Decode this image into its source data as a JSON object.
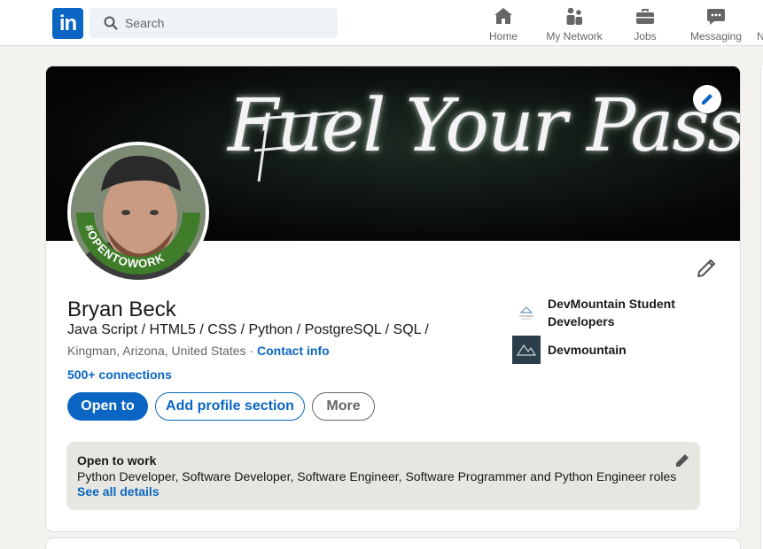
{
  "nav": {
    "logo": "in",
    "search_placeholder": "Search",
    "items": [
      {
        "label": "Home",
        "icon": "home-icon"
      },
      {
        "label": "My Network",
        "icon": "my-network-icon"
      },
      {
        "label": "Jobs",
        "icon": "jobs-icon"
      },
      {
        "label": "Messaging",
        "icon": "messaging-icon"
      },
      {
        "label": "N",
        "icon": "notifications-icon"
      }
    ]
  },
  "profile": {
    "banner_text": "Fuel Your Passion",
    "avatar_badge": "#OPENTOWORK",
    "name": "Bryan Beck",
    "headline": "Java Script / HTML5 / CSS / Python / PostgreSQL / SQL /",
    "location": "Kingman, Arizona, United States",
    "separator": " · ",
    "contact_info": "Contact info",
    "connections": "500+ connections",
    "buttons": {
      "open_to": "Open to",
      "add_section": "Add profile section",
      "more": "More"
    },
    "orgs": [
      {
        "name": "DevMountain Student Developers",
        "logo": "devmountain-student-logo"
      },
      {
        "name": "Devmountain",
        "logo": "devmountain-logo"
      }
    ]
  },
  "open_to_work": {
    "title": "Open to work",
    "roles": "Python Developer, Software Developer, Software Engineer, Software Programmer and Python Engineer roles",
    "link": "See all details"
  },
  "colors": {
    "brand": "#0a66c2",
    "otw_green": "#3f7d2a",
    "page_bg": "#f3f2ef",
    "otw_box": "#e8e6e1"
  }
}
